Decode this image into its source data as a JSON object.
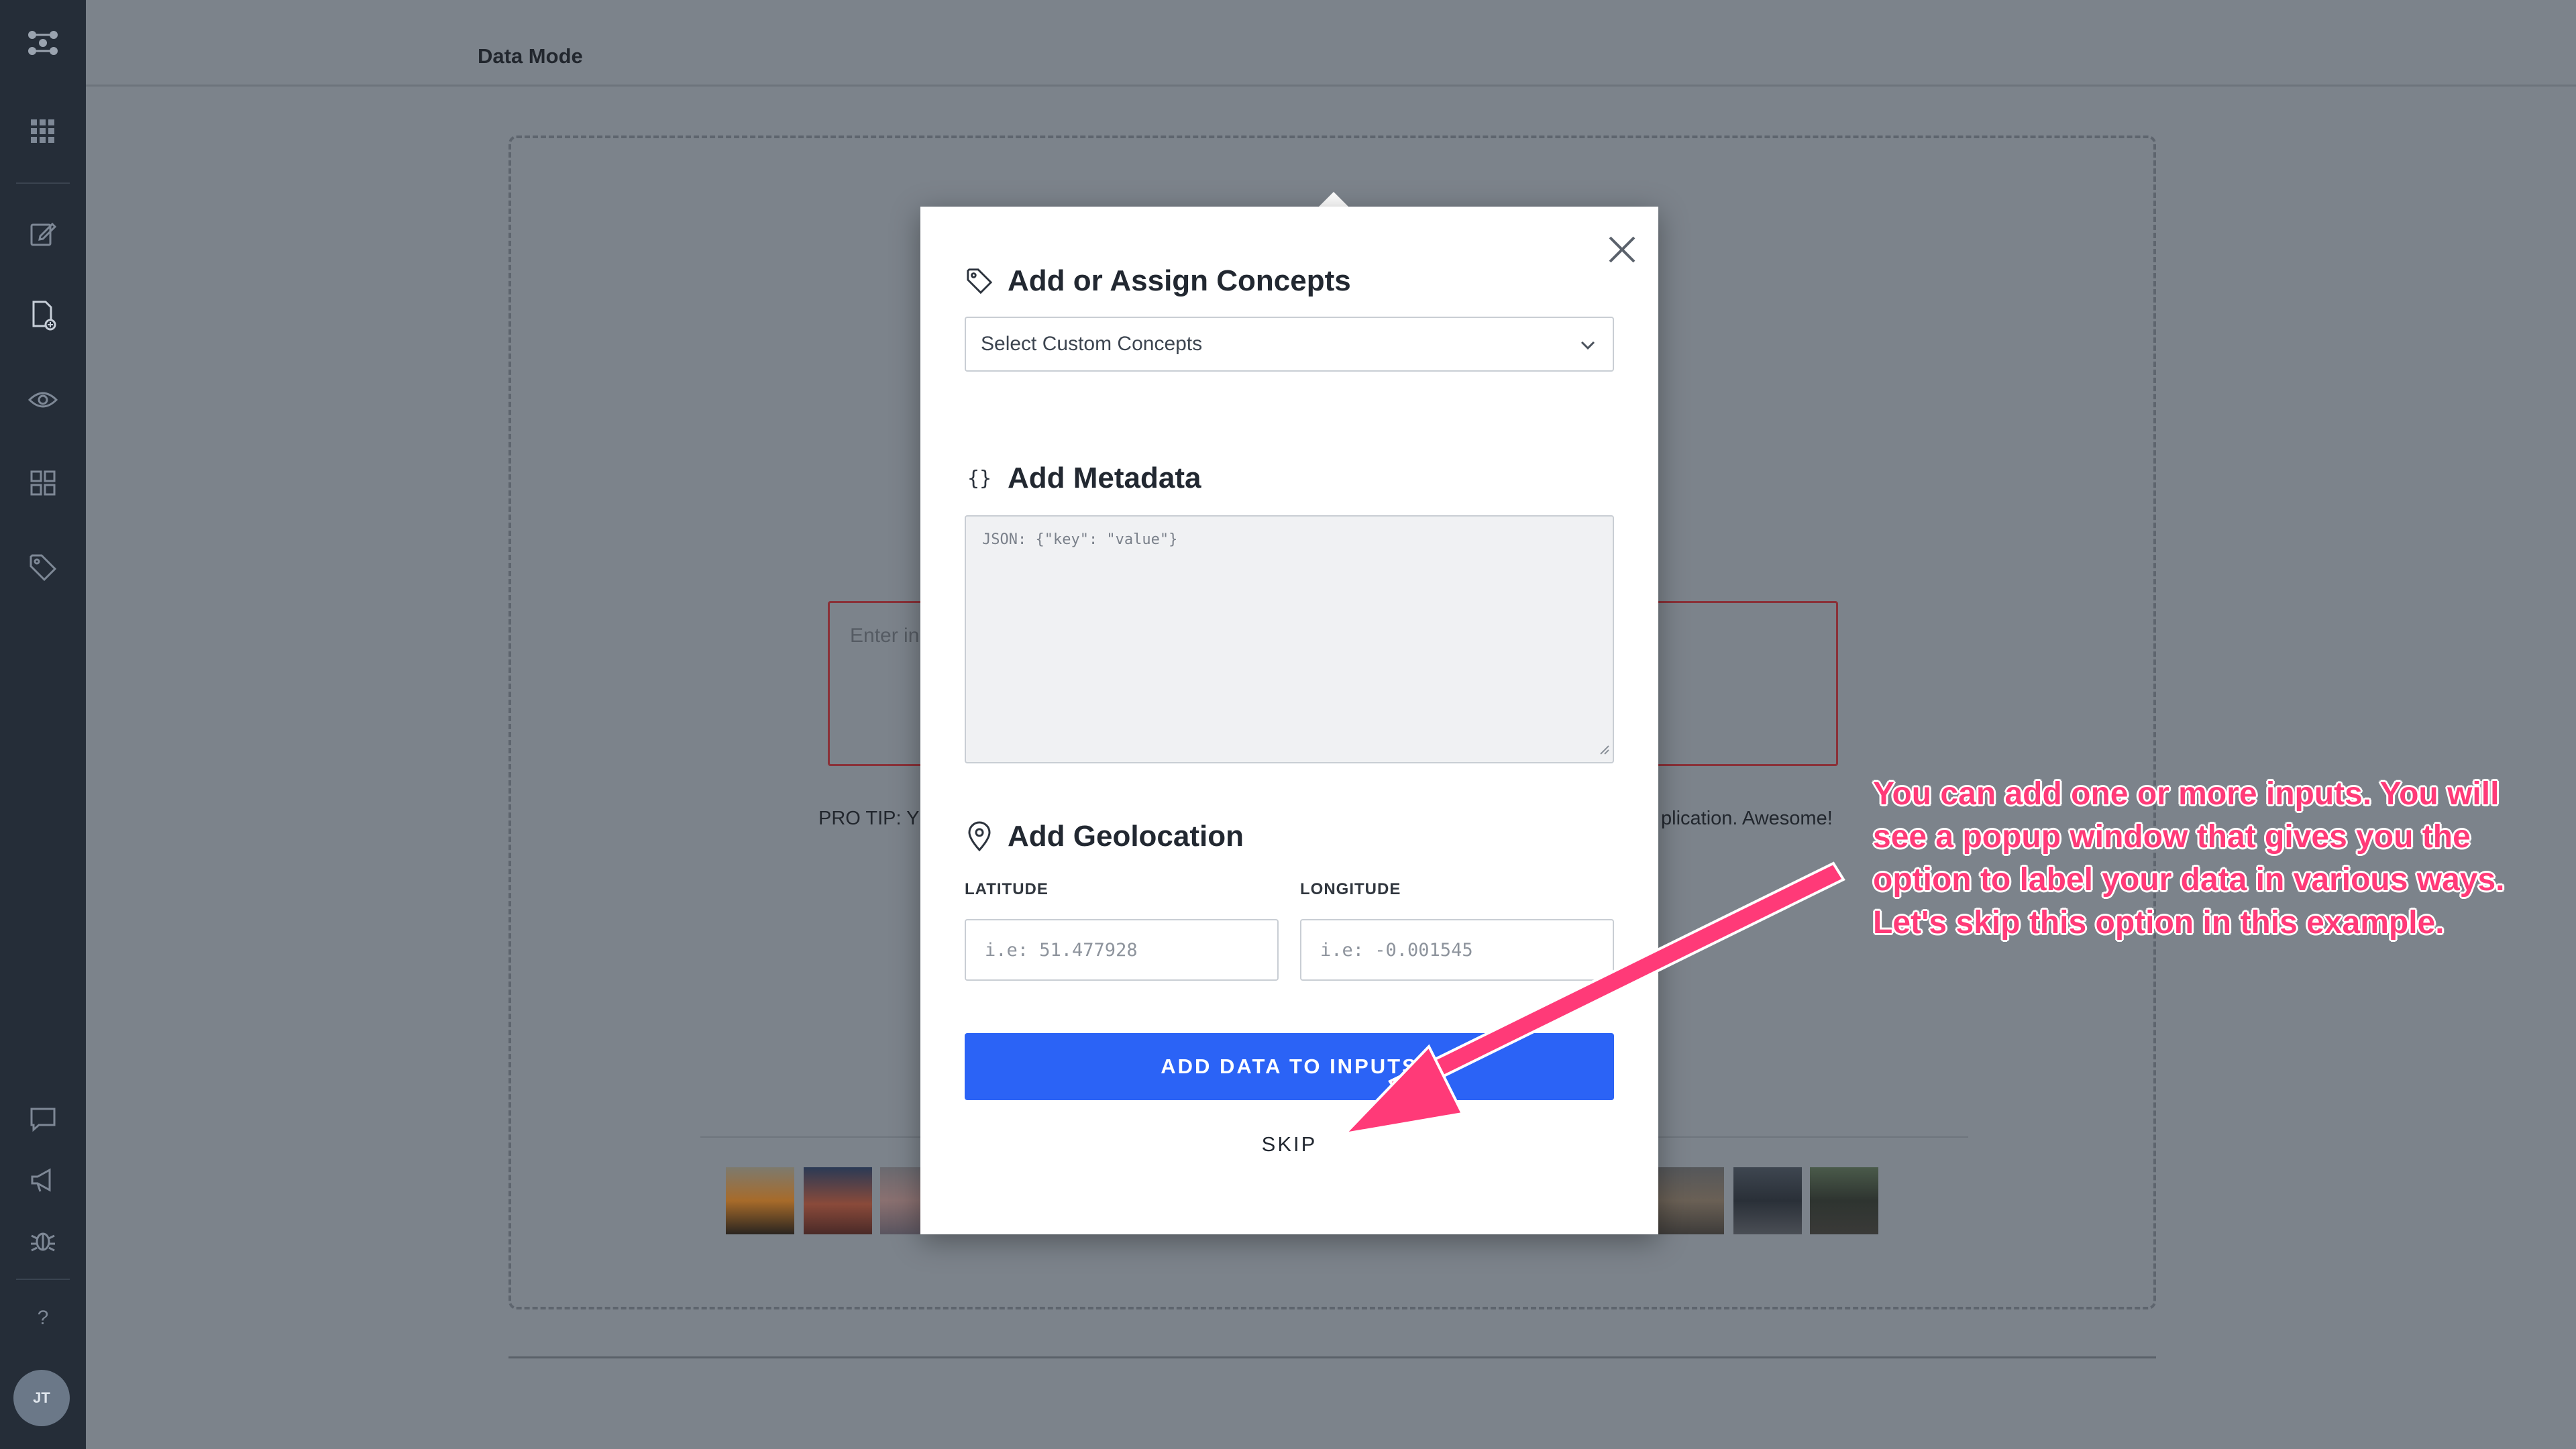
{
  "app": {
    "mode_title": "Data Mode",
    "user_initials": "JT",
    "help_label": "?"
  },
  "sidebar": {
    "items": [
      {
        "icon": "apps-grid-icon"
      },
      {
        "icon": "edit-icon"
      },
      {
        "icon": "add-file-icon"
      },
      {
        "icon": "eye-icon"
      },
      {
        "icon": "dashboard-icon"
      },
      {
        "icon": "tag-icon"
      },
      {
        "icon": "chat-icon"
      },
      {
        "icon": "megaphone-icon"
      },
      {
        "icon": "bug-icon"
      }
    ]
  },
  "background": {
    "input_placeholder": "Enter in",
    "tip_left": "PRO TIP: Y",
    "tip_right": "plication. Awesome!"
  },
  "modal": {
    "concepts_title": "Add or Assign Concepts",
    "concepts_placeholder": "Select Custom Concepts",
    "metadata_title": "Add Metadata",
    "metadata_placeholder": "JSON: {\"key\": \"value\"}",
    "geo_title": "Add Geolocation",
    "latitude_label": "LATITUDE",
    "longitude_label": "LONGITUDE",
    "latitude_placeholder": "i.e: 51.477928",
    "longitude_placeholder": "i.e: -0.001545",
    "add_button": "ADD DATA TO INPUTS",
    "skip_button": "SKIP"
  },
  "annotation": {
    "text": "You can add one or more inputs. You will see a popup window that gives you the option to label your data in various ways. Let's skip this option in this example.",
    "color": "#ff3a78"
  },
  "colors": {
    "accent": "#2b63f6",
    "sidebar_bg": "#252d38",
    "overlay_bg": "#7c838b"
  }
}
